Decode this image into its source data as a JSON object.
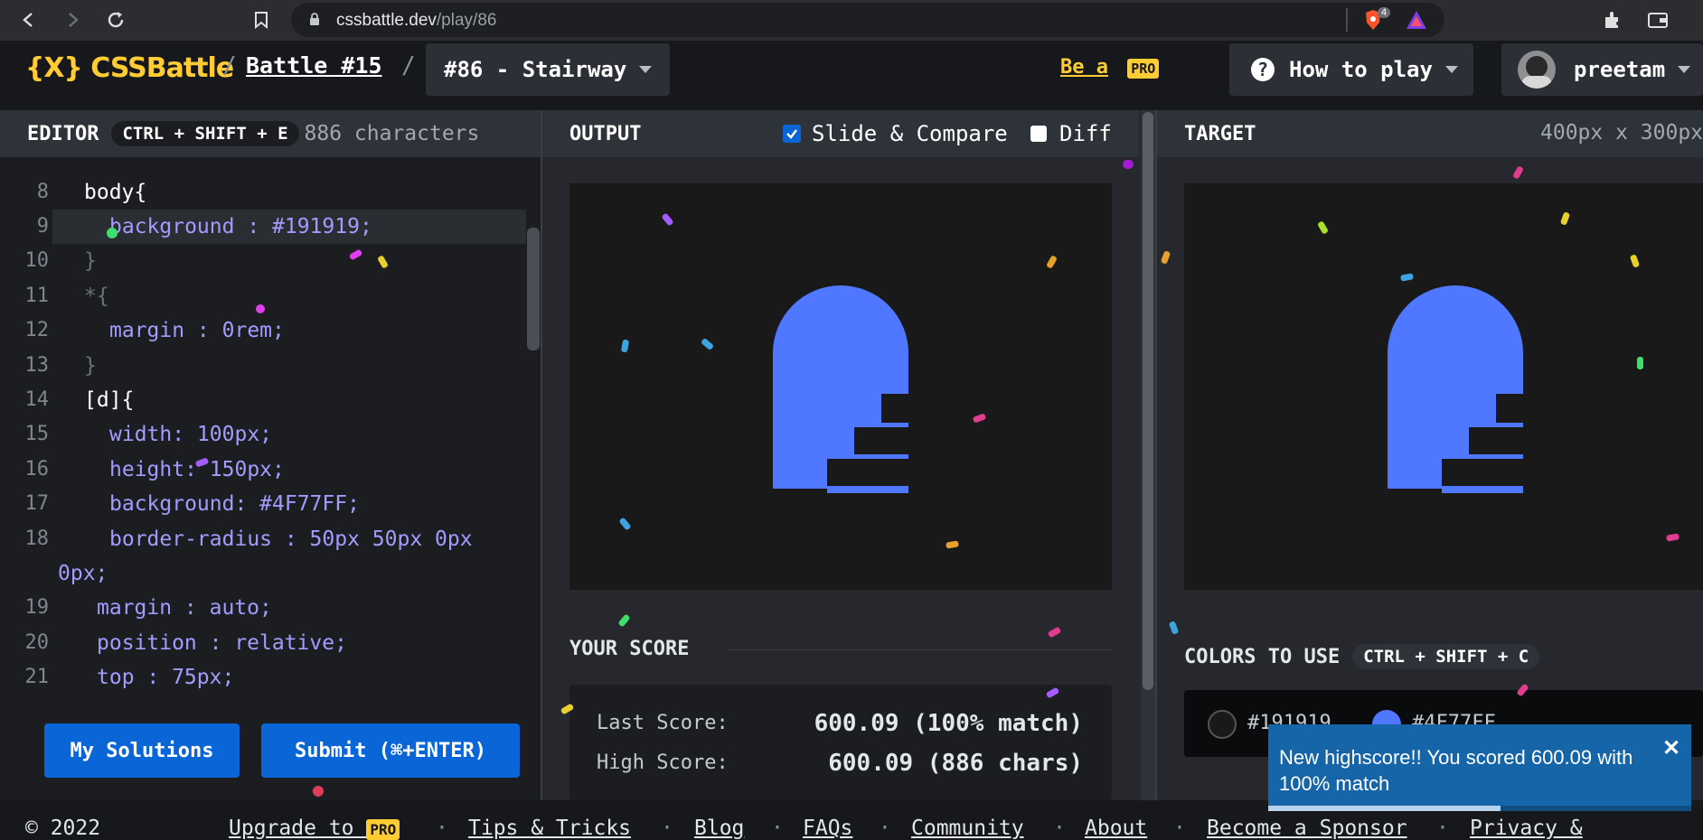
{
  "browser": {
    "url_host": "cssbattle.dev",
    "url_path": "/play/86",
    "brave_badge": "4"
  },
  "header": {
    "logo": "{X} CSSBattle",
    "battle": "Battle #15",
    "target_dropdown": "#86 - Stairway",
    "be_a": "Be a",
    "pro": "PRO",
    "how_to_play": "How to play",
    "user": "preetam"
  },
  "editor": {
    "title": "EDITOR",
    "shortcut": "CTRL + SHIFT + E",
    "char_count": "886 characters",
    "lines": [
      {
        "n": "8",
        "code": "body{"
      },
      {
        "n": "9",
        "code": "background : #191919;"
      },
      {
        "n": "10",
        "code": "}"
      },
      {
        "n": "11",
        "code": "*{"
      },
      {
        "n": "12",
        "code": "margin : 0rem;"
      },
      {
        "n": "13",
        "code": "}"
      },
      {
        "n": "14",
        "code": "[d]{"
      },
      {
        "n": "15",
        "code": "width: 100px;"
      },
      {
        "n": "16",
        "code": "height: 150px;"
      },
      {
        "n": "17",
        "code": "background: #4F77FF;"
      },
      {
        "n": "18",
        "code": "border-radius : 50px 50px 0px 0px;"
      },
      {
        "n": "19",
        "code": "margin : auto;"
      },
      {
        "n": "20",
        "code": "position : relative;"
      },
      {
        "n": "21",
        "code": "top : 75px;"
      }
    ],
    "my_solutions": "My Solutions",
    "submit": "Submit (⌘+ENTER)"
  },
  "output": {
    "title": "OUTPUT",
    "slide_compare": "Slide & Compare",
    "slide_compare_checked": true,
    "diff": "Diff",
    "diff_checked": false,
    "your_score": "YOUR SCORE",
    "last_score_label": "Last Score:",
    "last_score_value": "600.09 (100% match)",
    "high_score_label": "High Score:",
    "high_score_value": "600.09 (886 chars)"
  },
  "target": {
    "title": "TARGET",
    "size": "400px x 300px",
    "colors_title": "COLORS TO USE",
    "colors_shortcut": "CTRL + SHIFT + C",
    "colors": [
      {
        "hex": "#191919"
      },
      {
        "hex": "#4F77FF"
      }
    ]
  },
  "toast": {
    "message": "New highscore!! You scored 600.09 with 100% match",
    "progress": 0.55
  },
  "footer": {
    "copyright": "© 2022",
    "upgrade_to": "Upgrade to",
    "pro": "PRO",
    "tips": "Tips & Tricks",
    "blog": "Blog",
    "faqs": "FAQs",
    "community": "Community",
    "about": "About",
    "sponsor": "Become a Sponsor",
    "privacy": "Privacy &"
  },
  "colors": {
    "accent_blue": "#4F77FF",
    "canvas_bg": "#191919",
    "brand_yellow": "#ffcc33",
    "button_blue": "#0a66d6"
  }
}
